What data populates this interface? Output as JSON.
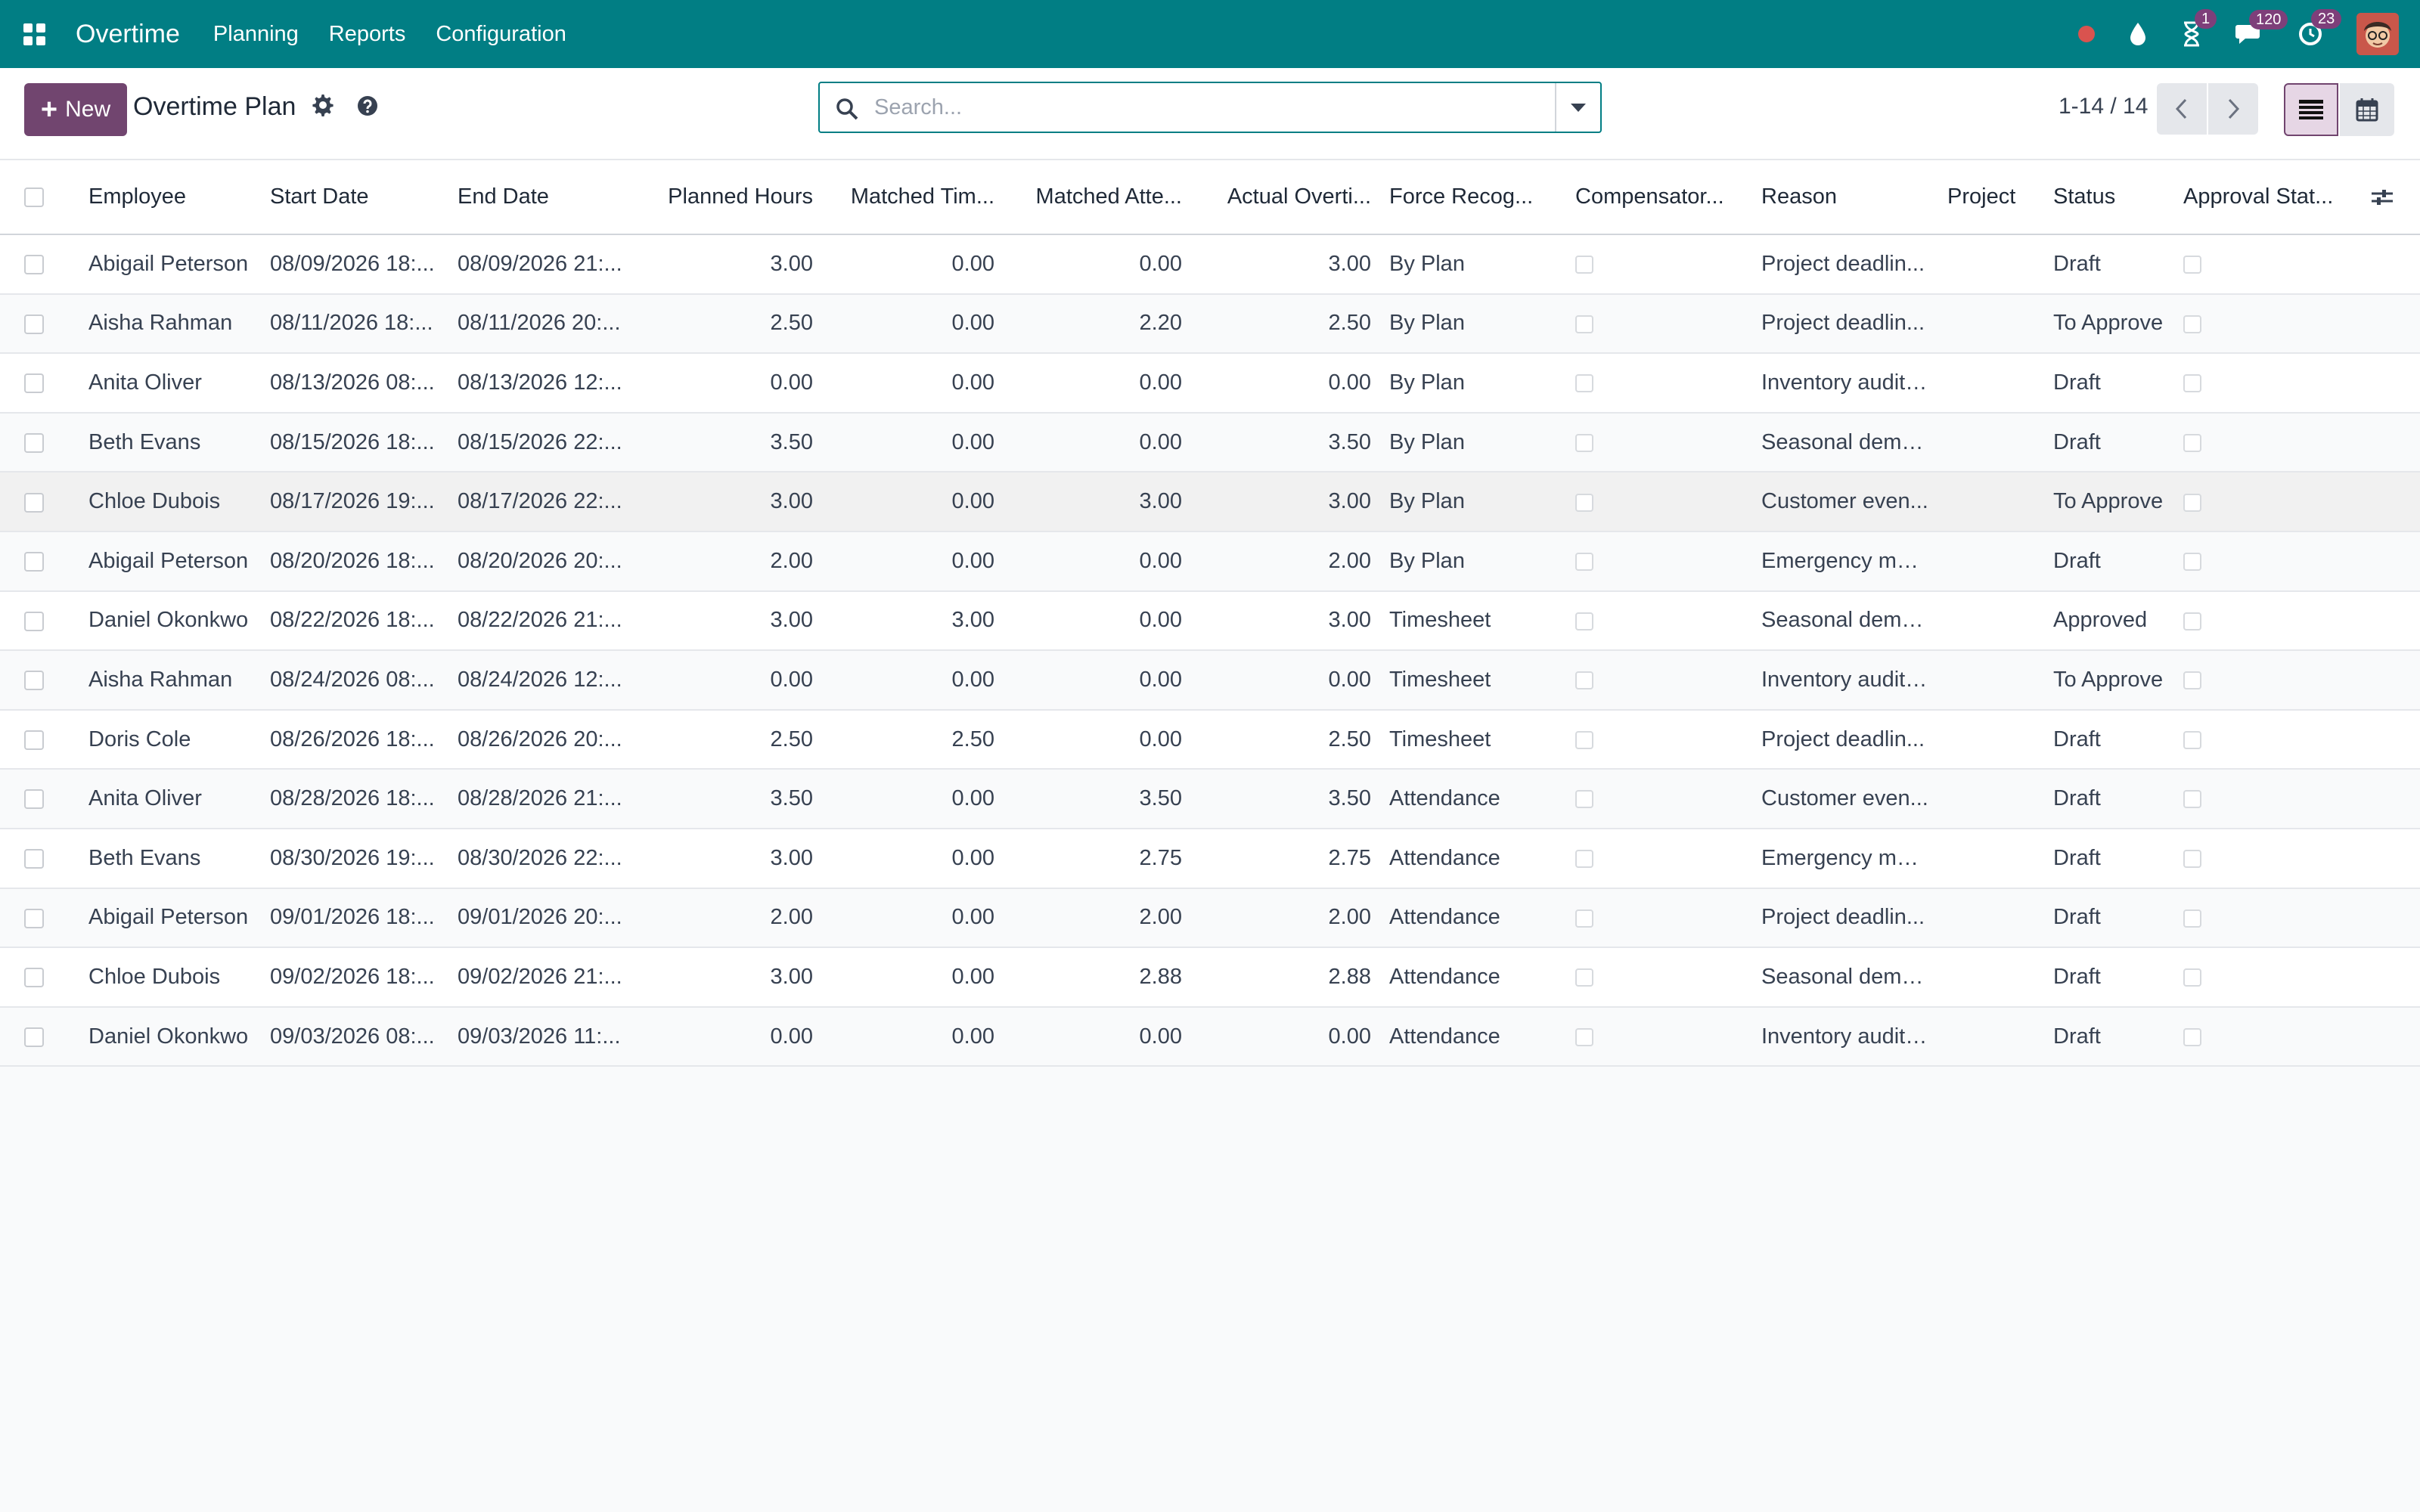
{
  "navbar": {
    "app_name": "Overtime",
    "menu": [
      "Planning",
      "Reports",
      "Configuration"
    ],
    "badges": {
      "activities": "1",
      "messages": "120",
      "timer": "23"
    },
    "color": "#017e84"
  },
  "control": {
    "new_label": "New",
    "title": "Overtime Plan",
    "search_placeholder": "Search...",
    "pager": "1-14 / 14",
    "accent": "#71456f"
  },
  "table": {
    "columns": [
      "Employee",
      "Start Date",
      "End Date",
      "Planned Hours",
      "Matched Tim...",
      "Matched Atte...",
      "Actual Overti...",
      "Force Recog...",
      "Compensator...",
      "Reason",
      "Project",
      "Status",
      "Approval Stat..."
    ],
    "rows": [
      {
        "employee": "Abigail Peterson",
        "start": "08/09/2026 18:...",
        "end": "08/09/2026 21:...",
        "planned": "3.00",
        "mtime": "0.00",
        "matt": "0.00",
        "actual": "3.00",
        "force": "By Plan",
        "reason": "Project deadlin...",
        "project": "",
        "status": "Draft"
      },
      {
        "employee": "Aisha Rahman",
        "start": "08/11/2026 18:...",
        "end": "08/11/2026 20:...",
        "planned": "2.50",
        "mtime": "0.00",
        "matt": "2.20",
        "actual": "2.50",
        "force": "By Plan",
        "reason": "Project deadlin...",
        "project": "",
        "status": "To Approve"
      },
      {
        "employee": "Anita Oliver",
        "start": "08/13/2026 08:...",
        "end": "08/13/2026 12:...",
        "planned": "0.00",
        "mtime": "0.00",
        "matt": "0.00",
        "actual": "0.00",
        "force": "By Plan",
        "reason": "Inventory audit ...",
        "project": "",
        "status": "Draft"
      },
      {
        "employee": "Beth Evans",
        "start": "08/15/2026 18:...",
        "end": "08/15/2026 22:...",
        "planned": "3.50",
        "mtime": "0.00",
        "matt": "0.00",
        "actual": "3.50",
        "force": "By Plan",
        "reason": "Seasonal dema...",
        "project": "",
        "status": "Draft"
      },
      {
        "employee": "Chloe Dubois",
        "start": "08/17/2026 19:...",
        "end": "08/17/2026 22:...",
        "planned": "3.00",
        "mtime": "0.00",
        "matt": "3.00",
        "actual": "3.00",
        "force": "By Plan",
        "reason": "Customer even...",
        "project": "",
        "status": "To Approve"
      },
      {
        "employee": "Abigail Peterson",
        "start": "08/20/2026 18:...",
        "end": "08/20/2026 20:...",
        "planned": "2.00",
        "mtime": "0.00",
        "matt": "0.00",
        "actual": "2.00",
        "force": "By Plan",
        "reason": "Emergency mai...",
        "project": "",
        "status": "Draft"
      },
      {
        "employee": "Daniel Okonkwo",
        "start": "08/22/2026 18:...",
        "end": "08/22/2026 21:...",
        "planned": "3.00",
        "mtime": "3.00",
        "matt": "0.00",
        "actual": "3.00",
        "force": "Timesheet",
        "reason": "Seasonal dema...",
        "project": "",
        "status": "Approved"
      },
      {
        "employee": "Aisha Rahman",
        "start": "08/24/2026 08:...",
        "end": "08/24/2026 12:...",
        "planned": "0.00",
        "mtime": "0.00",
        "matt": "0.00",
        "actual": "0.00",
        "force": "Timesheet",
        "reason": "Inventory audit ...",
        "project": "",
        "status": "To Approve"
      },
      {
        "employee": "Doris Cole",
        "start": "08/26/2026 18:...",
        "end": "08/26/2026 20:...",
        "planned": "2.50",
        "mtime": "2.50",
        "matt": "0.00",
        "actual": "2.50",
        "force": "Timesheet",
        "reason": "Project deadlin...",
        "project": "",
        "status": "Draft"
      },
      {
        "employee": "Anita Oliver",
        "start": "08/28/2026 18:...",
        "end": "08/28/2026 21:...",
        "planned": "3.50",
        "mtime": "0.00",
        "matt": "3.50",
        "actual": "3.50",
        "force": "Attendance",
        "reason": "Customer even...",
        "project": "",
        "status": "Draft"
      },
      {
        "employee": "Beth Evans",
        "start": "08/30/2026 19:...",
        "end": "08/30/2026 22:...",
        "planned": "3.00",
        "mtime": "0.00",
        "matt": "2.75",
        "actual": "2.75",
        "force": "Attendance",
        "reason": "Emergency mai...",
        "project": "",
        "status": "Draft"
      },
      {
        "employee": "Abigail Peterson",
        "start": "09/01/2026 18:...",
        "end": "09/01/2026 20:...",
        "planned": "2.00",
        "mtime": "0.00",
        "matt": "2.00",
        "actual": "2.00",
        "force": "Attendance",
        "reason": "Project deadlin...",
        "project": "",
        "status": "Draft"
      },
      {
        "employee": "Chloe Dubois",
        "start": "09/02/2026 18:...",
        "end": "09/02/2026 21:...",
        "planned": "3.00",
        "mtime": "0.00",
        "matt": "2.88",
        "actual": "2.88",
        "force": "Attendance",
        "reason": "Seasonal dema...",
        "project": "",
        "status": "Draft"
      },
      {
        "employee": "Daniel Okonkwo",
        "start": "09/03/2026 08:...",
        "end": "09/03/2026 11:...",
        "planned": "0.00",
        "mtime": "0.00",
        "matt": "0.00",
        "actual": "0.00",
        "force": "Attendance",
        "reason": "Inventory audit ...",
        "project": "",
        "status": "Draft"
      }
    ]
  }
}
